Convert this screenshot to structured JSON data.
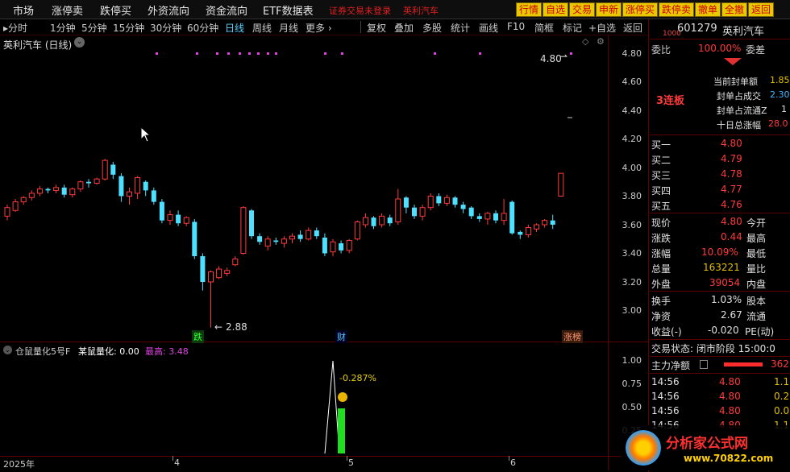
{
  "menu": {
    "items": [
      "市场",
      "涨停卖",
      "跌停买",
      "外资流向",
      "资金流向",
      "ETF数据表"
    ],
    "login_link": "证券交易未登录",
    "stock_link": "英利汽车",
    "buttons": [
      "行情",
      "自选",
      "交易",
      "申新",
      "涨停买",
      "跌停卖",
      "撤单",
      "全撤",
      "返回"
    ]
  },
  "toolbar": {
    "periods": [
      "分时",
      "1分钟",
      "5分钟",
      "15分钟",
      "30分钟",
      "60分钟",
      "日线",
      "周线",
      "月线",
      "更多 ›"
    ],
    "active_period": "日线",
    "tools": [
      "复权",
      "叠加",
      "多股",
      "统计",
      "画线",
      "F10",
      "简框",
      "标记",
      "+自选",
      "返回"
    ]
  },
  "chart": {
    "title": "英利汽车 (日线)",
    "price_axis": [
      "4.80",
      "4.60",
      "4.40",
      "4.20",
      "4.00",
      "3.80",
      "3.60",
      "3.40",
      "3.20",
      "3.00"
    ],
    "high_marker": "4.80",
    "low_marker": "2.88",
    "badges": {
      "fall": "跌",
      "finance": "财",
      "limit": "涨榜"
    },
    "up_color": "#ff3b3b",
    "down_color": "#4fe0ff"
  },
  "indicator": {
    "name": "仓鼠量化5号F",
    "value_label": "某鼠量化: 0.00",
    "max_label": "最高: 3.48",
    "annotation": "-0.287%",
    "axis": [
      "1.00",
      "0.75",
      "0.50",
      "0.25"
    ]
  },
  "time_axis": [
    "2025年",
    "4",
    "5",
    "6"
  ],
  "quote": {
    "code_prefix": "1000",
    "code": "601279",
    "name": "英利汽车",
    "wei_bi_label": "委比",
    "wei_bi_value": "100.00%",
    "wei_cha_label": "委差",
    "streak": "3连板",
    "seal_info": [
      {
        "label": "当前封单额",
        "value": "1.85"
      },
      {
        "label": "封单占成交",
        "value": "2.30"
      },
      {
        "label": "封单占流通Z",
        "value": "1"
      },
      {
        "label": "十日总涨幅",
        "value": "28.0"
      }
    ],
    "bids": [
      {
        "label": "买一",
        "price": "4.80"
      },
      {
        "label": "买二",
        "price": "4.79"
      },
      {
        "label": "买三",
        "price": "4.78"
      },
      {
        "label": "买四",
        "price": "4.77"
      },
      {
        "label": "买五",
        "price": "4.76"
      }
    ],
    "stats": [
      {
        "label": "现价",
        "value": "4.80",
        "label2": "今开"
      },
      {
        "label": "涨跌",
        "value": "0.44",
        "label2": "最高"
      },
      {
        "label": "涨幅",
        "value": "10.09%",
        "label2": "最低"
      },
      {
        "label": "总量",
        "value": "163221",
        "label2": "量比"
      },
      {
        "label": "外盘",
        "value": "39054",
        "label2": "内盘"
      }
    ],
    "stats2": [
      {
        "label": "换手",
        "value": "1.03%",
        "label2": "股本"
      },
      {
        "label": "净资",
        "value": "2.67",
        "label2": "流通"
      },
      {
        "label": "收益(-)",
        "value": "-0.020",
        "label2": "PE(动)"
      }
    ],
    "trade_state": "交易状态: 闭市阶段 15:00:0",
    "main_flow": "主力净额",
    "main_flow_value": "362",
    "ticks": [
      {
        "time": "14:56",
        "price": "4.80",
        "vol": "1.1"
      },
      {
        "time": "14:56",
        "price": "4.80",
        "vol": "0.2"
      },
      {
        "time": "14:56",
        "price": "4.80",
        "vol": "0.0"
      },
      {
        "time": "14:56",
        "price": "4.80",
        "vol": "1.1"
      }
    ]
  },
  "watermark": {
    "text": "分析家公式网",
    "url": "www.70822.com"
  }
}
